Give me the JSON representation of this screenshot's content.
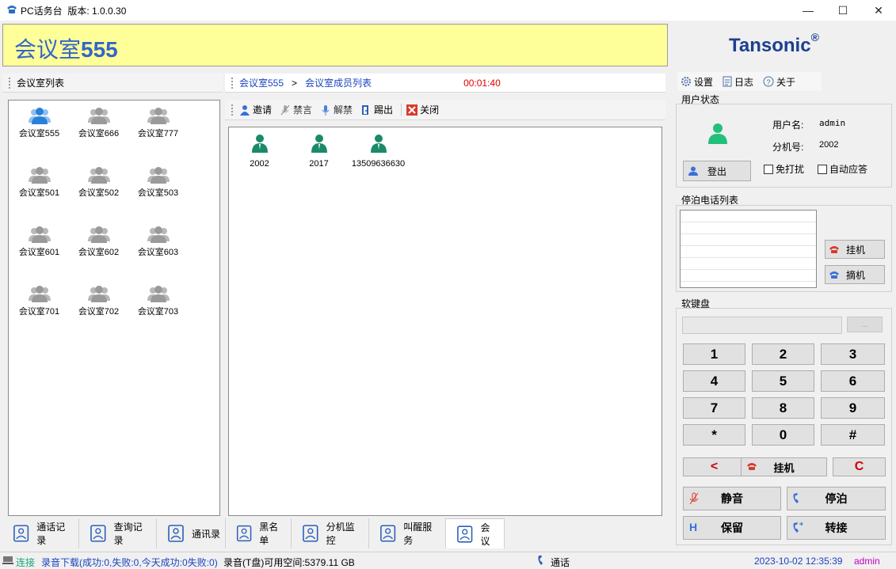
{
  "window": {
    "title": "PC话务台",
    "version_label": "版本: 1.0.0.30",
    "minimize": "—",
    "maximize": "☐",
    "close": "✕"
  },
  "banner": {
    "prefix": "会议室",
    "number": "555"
  },
  "logo": {
    "text": "Tansonic",
    "mark": "®"
  },
  "rooms_panel": {
    "title": "会议室列表",
    "rooms": [
      "会议室555",
      "会议室666",
      "会议室777",
      "会议室501",
      "会议室502",
      "会议室503",
      "会议室601",
      "会议室602",
      "会议室603",
      "会议室701",
      "会议室702",
      "会议室703"
    ]
  },
  "members_panel": {
    "breadcrumb_room": "会议室555",
    "breadcrumb_sep": ">",
    "breadcrumb_page": "会议室成员列表",
    "timer": "00:01:40",
    "toolbar": {
      "invite": "邀请",
      "mute": "禁言",
      "unmute": "解禁",
      "kick": "踢出",
      "close": "关闭"
    },
    "members": [
      "2002",
      "2017",
      "13509636630"
    ]
  },
  "top_menu": {
    "settings": "设置",
    "log": "日志",
    "about": "关于"
  },
  "user_status": {
    "title": "用户状态",
    "username_label": "用户名:",
    "username": "admin",
    "ext_label": "分机号:",
    "ext": "2002",
    "logout": "登出",
    "dnd": "免打扰",
    "auto_answer": "自动应答"
  },
  "parked": {
    "title": "停泊电话列表",
    "hangup": "挂机",
    "pickup": "摘机"
  },
  "keypad": {
    "title": "软键盘",
    "input_value": "",
    "more": "...",
    "keys": [
      "1",
      "2",
      "3",
      "4",
      "5",
      "6",
      "7",
      "8",
      "9",
      "*",
      "0",
      "#"
    ],
    "backspace": "<",
    "hangup": "挂机",
    "clear": "C",
    "mute": "静音",
    "park": "停泊",
    "hold": "保留",
    "hold_icon": "H",
    "transfer": "转接"
  },
  "tabs": [
    "通话记录",
    "查询记录",
    "通讯录",
    "黑名单",
    "分机监控",
    "叫醒服务",
    "会议"
  ],
  "status": {
    "connection": "连接",
    "recording": "录音下载(成功:0,失败:0,今天成功:0失败:0)",
    "disk": "录音(T盘)可用空间:5379.11 GB",
    "call": "通话",
    "datetime": "2023-10-02 12:35:39",
    "user": "admin"
  },
  "colors": {
    "banner_bg": "#ffff99",
    "banner_text": "#3465c8",
    "logo": "#1d3f8f",
    "timer": "#e00000",
    "link": "#1a44c0",
    "accent_green": "#1aa57a",
    "user": "#c000c0"
  }
}
